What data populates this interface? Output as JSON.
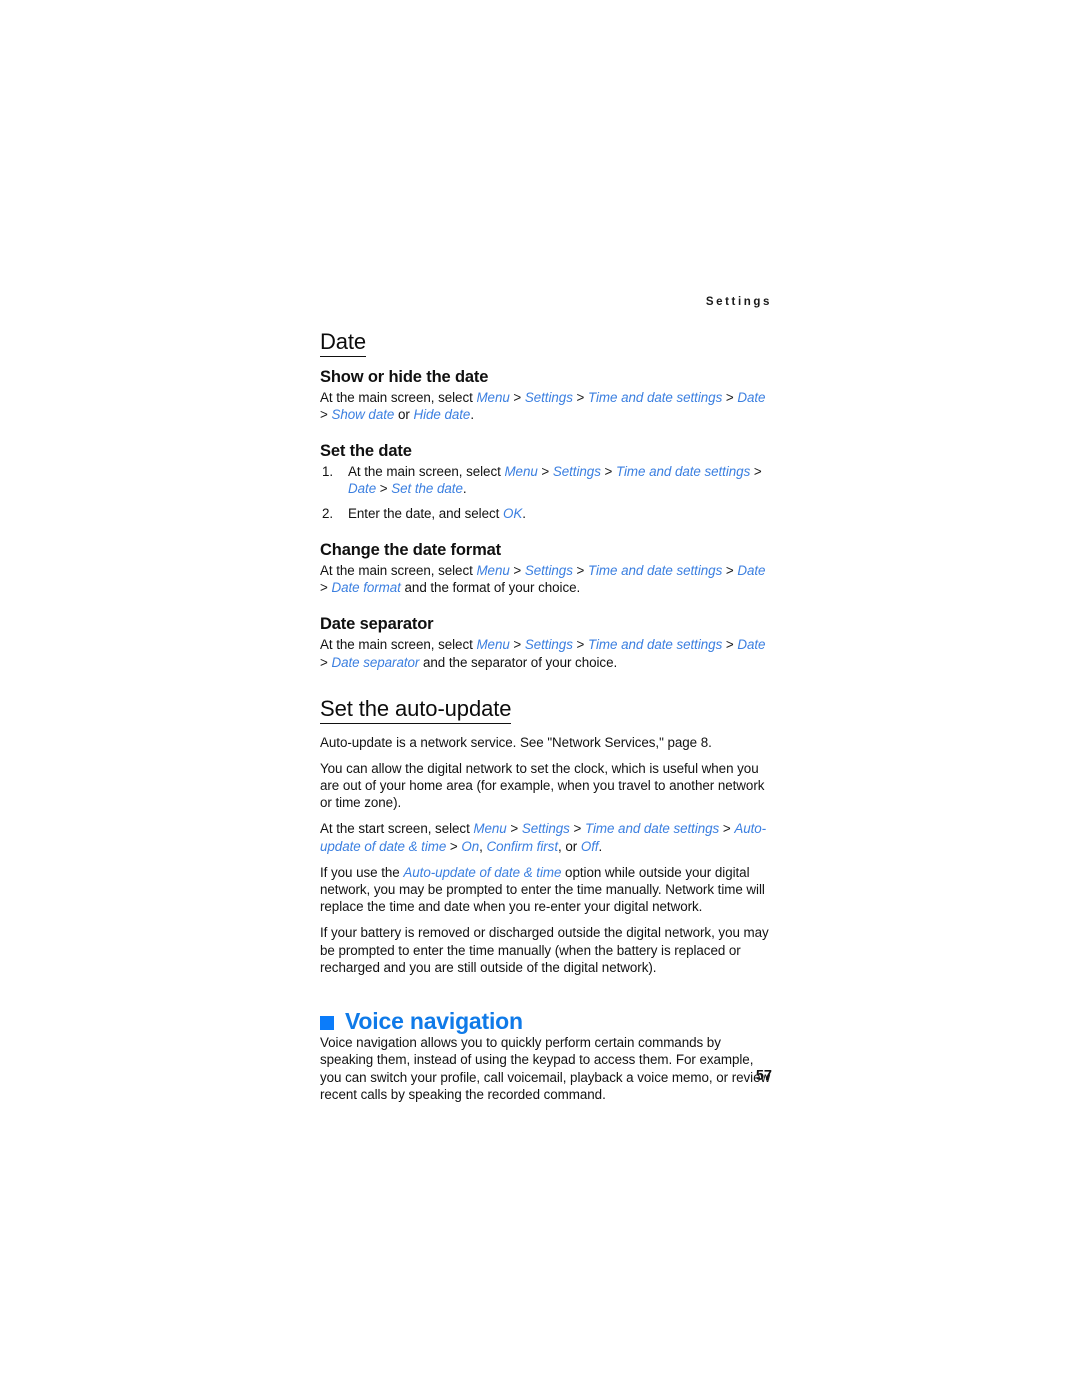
{
  "document": {
    "running_header": "Settings",
    "page_number": "57"
  },
  "sections": {
    "date": {
      "heading": "Date",
      "show_hide": {
        "heading": "Show or hide the date",
        "line1_pre": "At the main screen, select ",
        "path": [
          "Menu",
          "Settings",
          "Time and date settings",
          "Date"
        ],
        "options": [
          "Show date",
          "Hide date"
        ],
        "options_joiner": " or ",
        "terminator": "."
      },
      "set_date": {
        "heading": "Set the date",
        "steps": [
          {
            "num": "1.",
            "pre": "At the main screen, select ",
            "path": [
              "Menu",
              "Settings",
              "Time and date settings",
              "Date",
              "Set the date"
            ],
            "post": "."
          },
          {
            "num": "2.",
            "pre": "Enter the date, and select ",
            "path": [
              "OK"
            ],
            "post": "."
          }
        ]
      },
      "date_format": {
        "heading": "Change the date format",
        "pre": "At the main screen, select ",
        "path": [
          "Menu",
          "Settings",
          "Time and date settings",
          "Date",
          "Date format"
        ],
        "post": " and the format of your choice."
      },
      "date_separator": {
        "heading": "Date separator",
        "pre": "At the main screen, select ",
        "path": [
          "Menu",
          "Settings",
          "Time and date settings",
          "Date",
          "Date separator"
        ],
        "post": " and the separator of your choice."
      }
    },
    "auto_update": {
      "heading": "Set the auto-update",
      "p1": "Auto-update is a network service. See \"Network Services,\" page 8.",
      "p2": "You can allow the digital network to set the clock, which is useful when you are out of your home area (for example, when you travel to another network or time zone).",
      "p3": {
        "pre": "At the start screen, select ",
        "path": [
          "Menu",
          "Settings",
          "Time and date settings",
          "Auto-update of date & time"
        ],
        "choices": [
          "On",
          "Confirm first",
          "Off"
        ],
        "choices_sep": ", ",
        "choices_last_joiner": ", or ",
        "post": "."
      },
      "p4": {
        "pre": "If you use the ",
        "term": "Auto-update of date & time",
        "post": " option while outside your digital network, you may be prompted to enter the time manually. Network time will replace the time and date when you re-enter your digital network."
      },
      "p5": "If your battery is removed or discharged outside the digital network, you may be prompted to enter the time manually (when the battery is replaced or recharged and you are still outside of the digital network)."
    },
    "voice_navigation": {
      "heading": "Voice navigation",
      "bullet_color": "#0b7cfa",
      "heading_color": "#0f7ae8",
      "p1": "Voice navigation allows you to quickly perform certain commands by speaking them, instead of using the keypad to access them. For example, you can switch your profile, call voicemail, playback a voice memo, or review recent calls by speaking the recorded command."
    }
  }
}
